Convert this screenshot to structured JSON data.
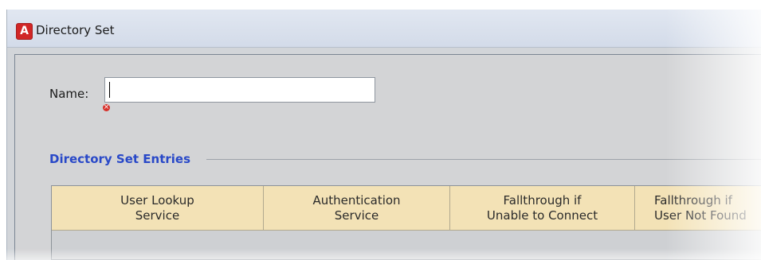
{
  "window": {
    "title": "Directory Set",
    "icon": "app-logo-icon",
    "icon_letter": "A",
    "accent_color": "#d12626"
  },
  "form": {
    "name_label": "Name:",
    "name_value": "",
    "name_placeholder": "",
    "validation_icon": "error-x-icon",
    "section_title": "Directory Set Entries",
    "section_title_color": "#2848c8"
  },
  "grid": {
    "header_color": "#f3e2b6",
    "columns": [
      "User Lookup\nService",
      "Authentication\nService",
      "Fallthrough if\nUnable to Connect",
      "Fallthrough if\nUser Not Found"
    ],
    "rows": []
  }
}
